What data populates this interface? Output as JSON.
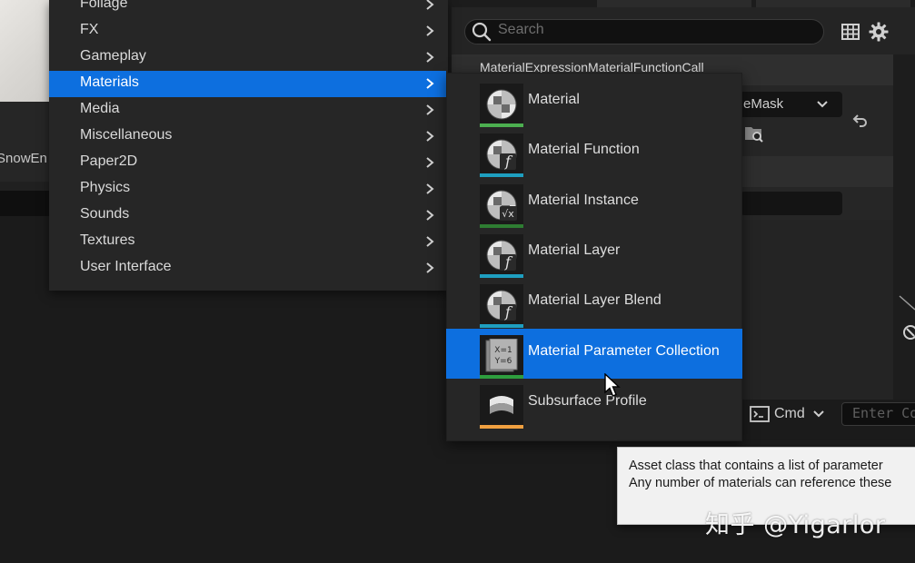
{
  "background": {
    "left_label": "SnowEn",
    "details": {
      "search_placeholder": "Search",
      "section_title": "MaterialExpressionMaterialFunctionCall",
      "combo_value": "eMask"
    },
    "cmd": {
      "label": "Cmd",
      "input_placeholder": "Enter Co"
    }
  },
  "category_menu": {
    "items": [
      {
        "label": "Foliage",
        "selected": false
      },
      {
        "label": "FX",
        "selected": false
      },
      {
        "label": "Gameplay",
        "selected": false
      },
      {
        "label": "Materials",
        "selected": true
      },
      {
        "label": "Media",
        "selected": false
      },
      {
        "label": "Miscellaneous",
        "selected": false
      },
      {
        "label": "Paper2D",
        "selected": false
      },
      {
        "label": "Physics",
        "selected": false
      },
      {
        "label": "Sounds",
        "selected": false
      },
      {
        "label": "Textures",
        "selected": false
      },
      {
        "label": "User Interface",
        "selected": false
      }
    ]
  },
  "materials_submenu": {
    "items": [
      {
        "label": "Material",
        "icon": "material-sphere-icon",
        "color": "#4caf50",
        "selected": false
      },
      {
        "label": "Material Function",
        "icon": "material-function-icon",
        "color": "#1e9fc0",
        "selected": false
      },
      {
        "label": "Material Instance",
        "icon": "material-instance-icon",
        "color": "#2e7d32",
        "selected": false
      },
      {
        "label": "Material Layer",
        "icon": "material-layer-icon",
        "color": "#1e9fc0",
        "selected": false
      },
      {
        "label": "Material Layer Blend",
        "icon": "material-layer-blend-icon",
        "color": "#1e9fc0",
        "selected": false
      },
      {
        "label": "Material Parameter Collection",
        "icon": "parameter-collection-icon",
        "color": "#2e9e3e",
        "selected": true,
        "icon_text": [
          "X=1",
          "Y=6"
        ]
      },
      {
        "label": "Subsurface Profile",
        "icon": "subsurface-profile-icon",
        "color": "#f0a040",
        "selected": false
      }
    ]
  },
  "tooltip": {
    "lines": [
      "Asset class that contains a list of parameter",
      "Any number of materials can reference these"
    ]
  },
  "watermark": "知乎 @Yigarlor",
  "colors": {
    "selection": "#0d6fdf",
    "menu_bg": "#262626",
    "tooltip_bg": "#f1f1f1"
  }
}
